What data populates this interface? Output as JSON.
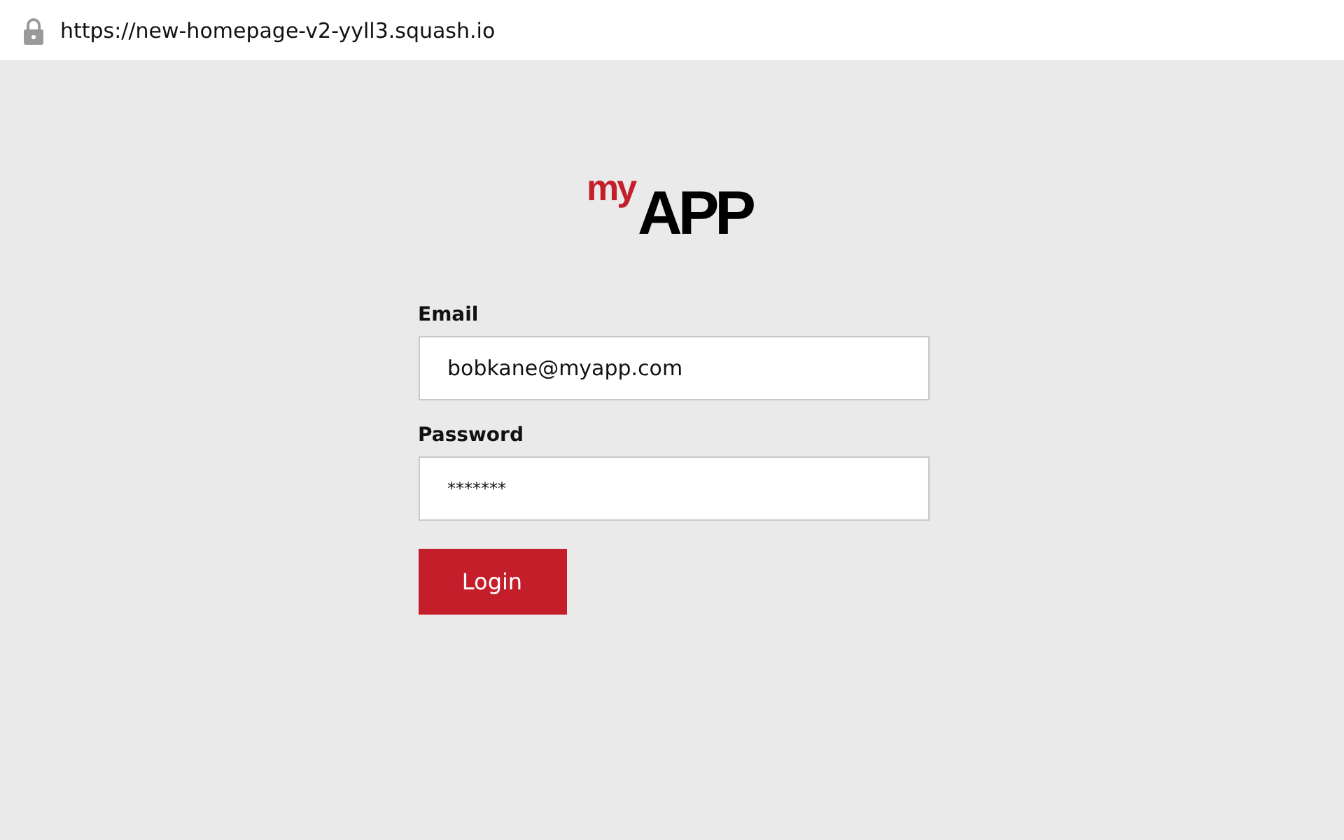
{
  "address_bar": {
    "url": "https://new-homepage-v2-yyll3.squash.io"
  },
  "logo": {
    "prefix": "my",
    "name": "APP"
  },
  "form": {
    "fields": [
      {
        "label": "Email",
        "value": "bobkane@myapp.com"
      },
      {
        "label": "Password",
        "value": "*******"
      }
    ],
    "button": "Login"
  }
}
